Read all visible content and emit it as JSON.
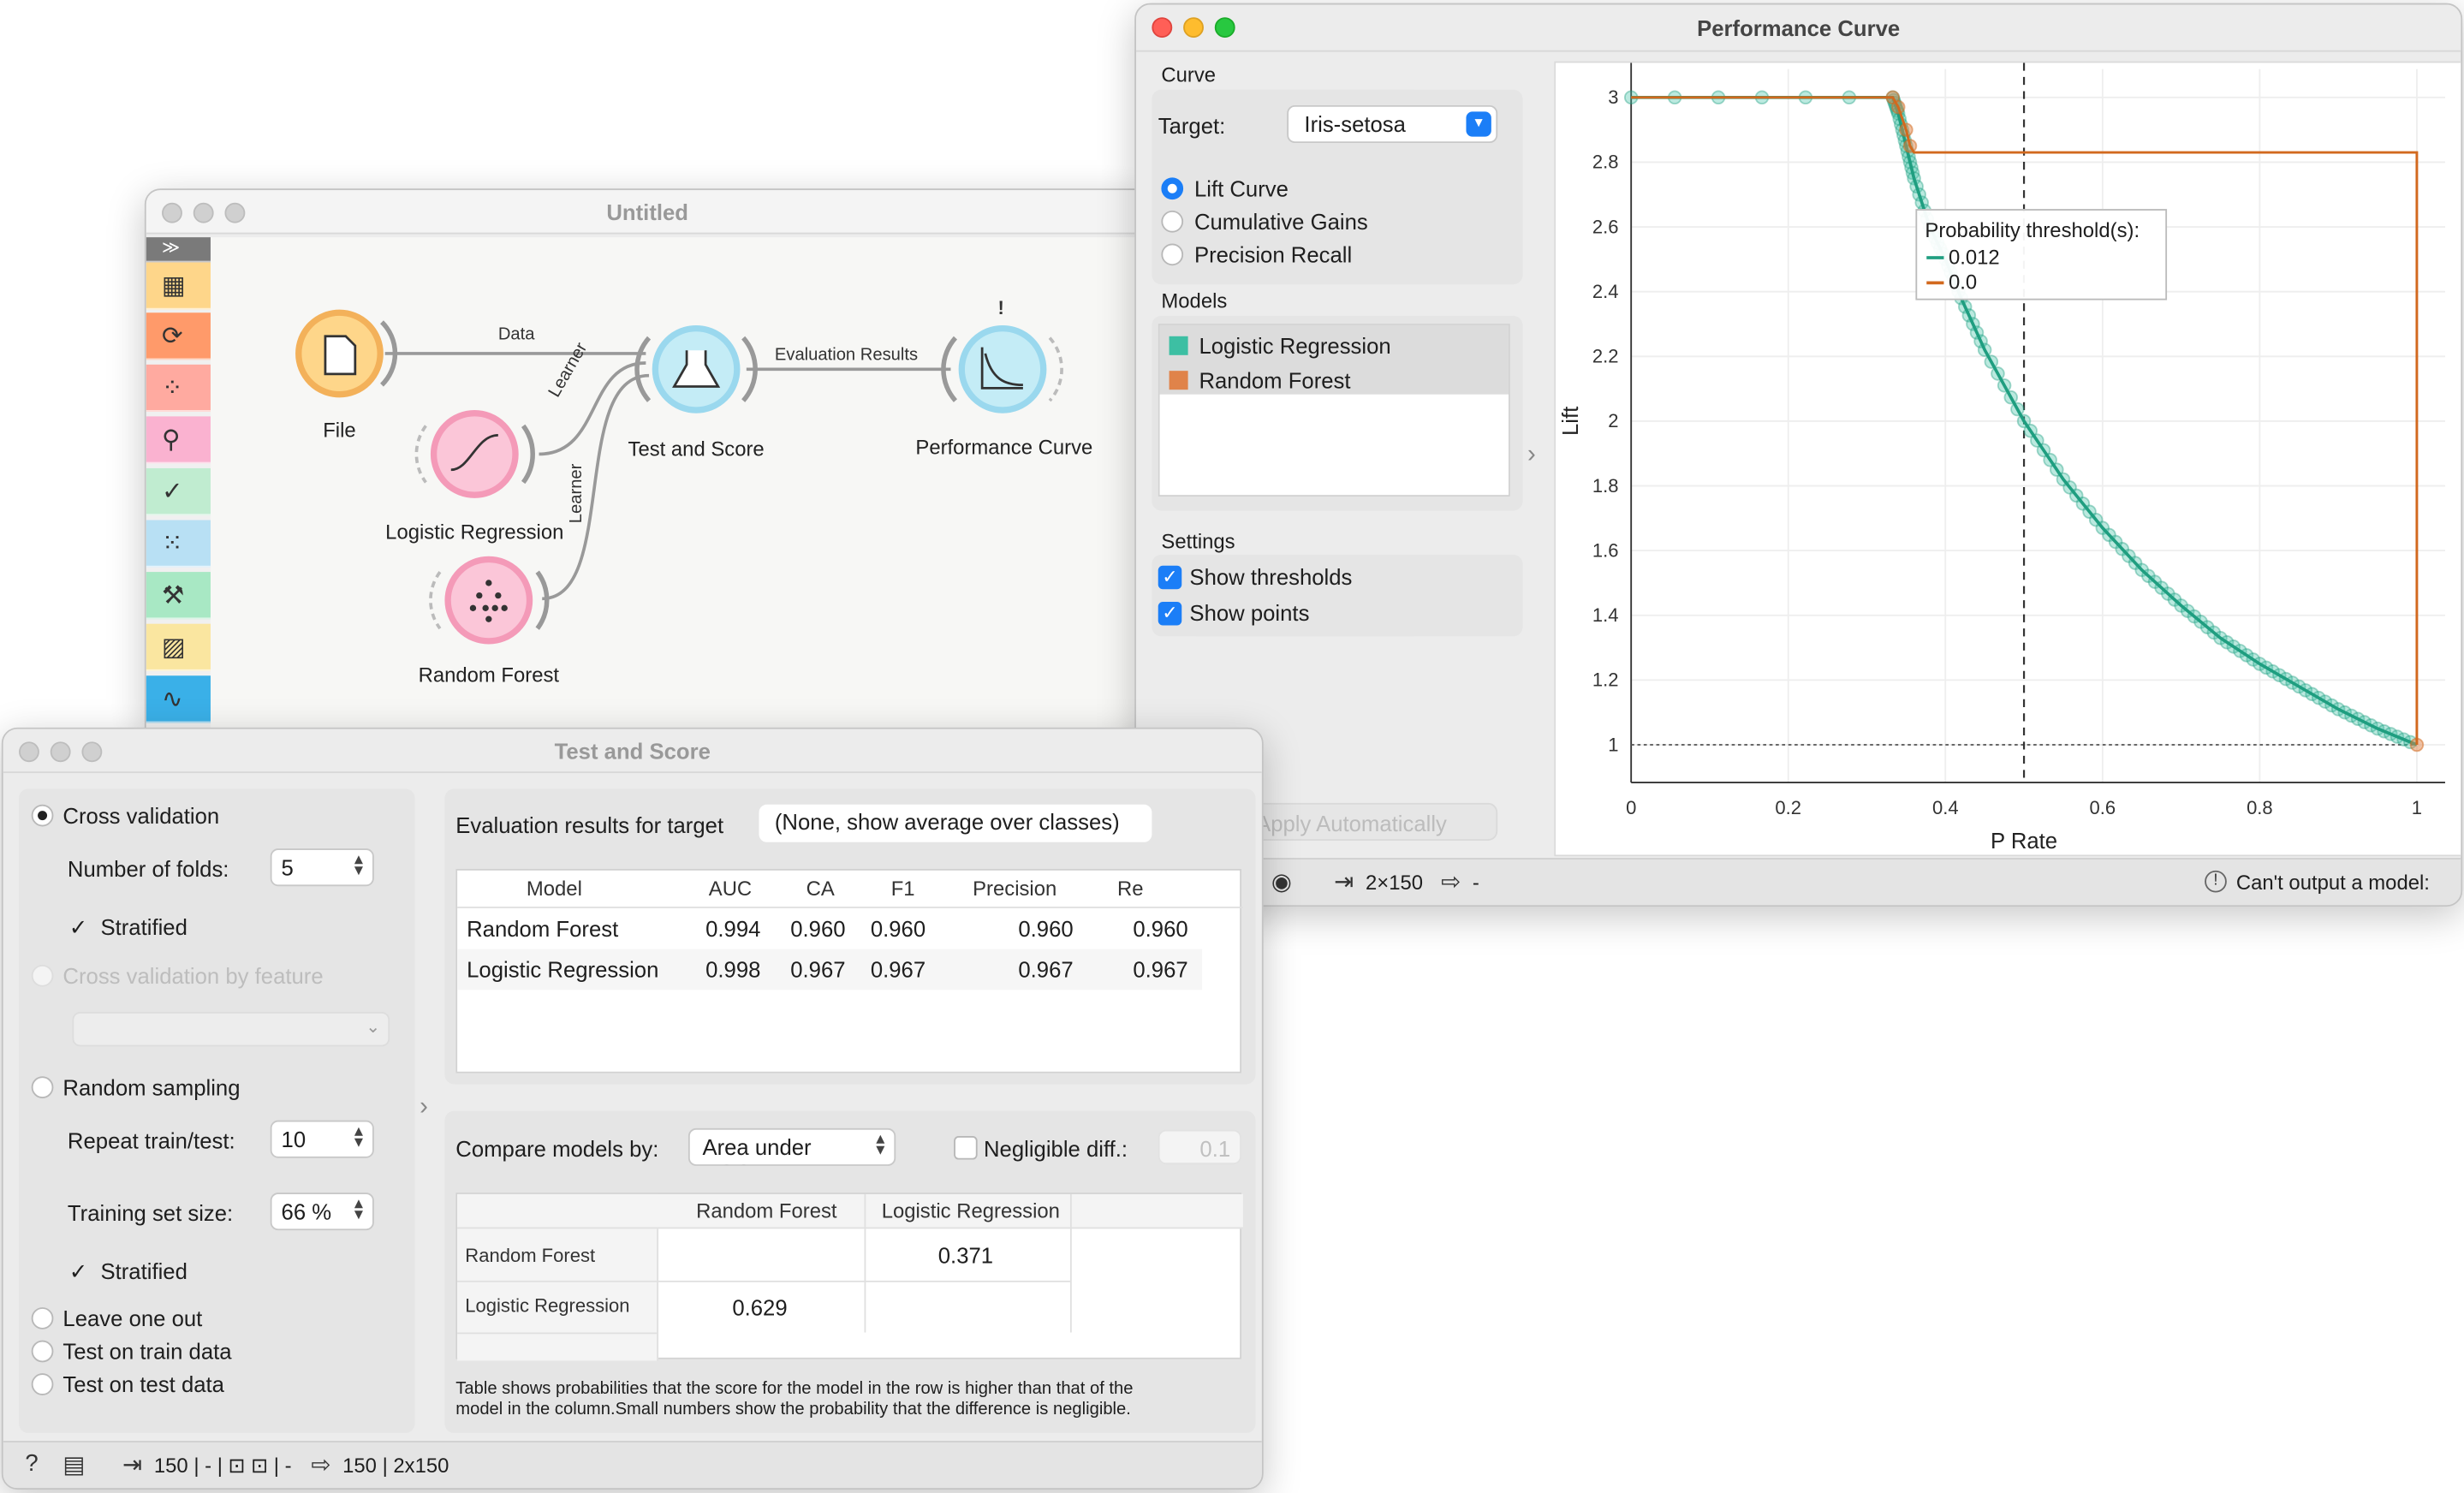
{
  "canvas_window": {
    "title": "Untitled",
    "nodes": {
      "file": "File",
      "logreg": "Logistic Regression",
      "testscore": "Test and Score",
      "perfcurve": "Performance Curve",
      "randforest": "Random Forest"
    },
    "links": {
      "data": "Data",
      "learner1": "Learner",
      "learner2": "Learner",
      "eval": "Evaluation Results"
    },
    "warning_badge": "!",
    "toolbox_icons": [
      "expand-icon",
      "data-table-icon",
      "transform-icon",
      "visualize-icon",
      "model-icon",
      "evaluate-icon",
      "unsupervised-icon",
      "spectroscopy-icon",
      "image-analytics-icon",
      "curve-icon"
    ]
  },
  "test_score_window": {
    "title": "Test and Score",
    "sampling": {
      "cross_validation": "Cross validation",
      "num_folds_label": "Number of folds:",
      "num_folds_value": "5",
      "stratified1": "Stratified",
      "cv_by_feature": "Cross validation by feature",
      "random_sampling": "Random sampling",
      "repeat_label": "Repeat train/test:",
      "repeat_value": "10",
      "train_size_label": "Training set size:",
      "train_size_value": "66 %",
      "stratified2": "Stratified",
      "leave_one_out": "Leave one out",
      "test_on_train": "Test on train data",
      "test_on_test": "Test on test data"
    },
    "eval_target_label": "Evaluation results for target",
    "eval_target_value": "(None, show average over classes)",
    "results_table": {
      "headers": [
        "Model",
        "AUC",
        "CA",
        "F1",
        "Precision",
        "Re"
      ],
      "rows": [
        [
          "Random Forest",
          "0.994",
          "0.960",
          "0.960",
          "0.960",
          "0.960"
        ],
        [
          "Logistic Regression",
          "0.998",
          "0.967",
          "0.967",
          "0.967",
          "0.967"
        ]
      ]
    },
    "compare_label": "Compare models by:",
    "compare_value": "Area under ROC",
    "negligible_label": "Negligible diff.:",
    "negligible_value": "0.1",
    "compare_table": {
      "headers": [
        "Random Forest",
        "Logistic Regression"
      ],
      "row_labels": [
        "Random Forest",
        "Logistic Regression"
      ],
      "values": [
        [
          "",
          "0.371"
        ],
        [
          "0.629",
          ""
        ]
      ]
    },
    "note_line1": "Table shows probabilities that the score for the model in the row is higher than that of the",
    "note_line2": "model in the column.Small numbers show the probability that the difference is negligible.",
    "status": {
      "input": "150 | - | ⊡ ⊡ | -",
      "output": "150 | 2x150"
    }
  },
  "perf_window": {
    "title": "Performance Curve",
    "curve_section": "Curve",
    "target_label": "Target:",
    "target_value": "Iris-setosa",
    "curve_options": [
      "Lift Curve",
      "Cumulative Gains",
      "Precision Recall"
    ],
    "selected_curve": "Lift Curve",
    "models_section": "Models",
    "models": [
      {
        "name": "Logistic Regression",
        "color": "#3dbfa3"
      },
      {
        "name": "Random Forest",
        "color": "#e0834a"
      }
    ],
    "settings_section": "Settings",
    "show_thresholds": "Show thresholds",
    "show_points": "Show points",
    "apply_auto": "Apply Automatically",
    "status": {
      "input": "2×150",
      "output": "-",
      "warning": "Can't output a model:"
    },
    "tooltip": {
      "title": "Probability threshold(s):",
      "lines": [
        {
          "text": "0.012",
          "color": "#1f9e80"
        },
        {
          "text": "0.0",
          "color": "#d2691e"
        }
      ]
    }
  },
  "chart_data": {
    "type": "line",
    "xlabel": "P Rate",
    "ylabel": "Lift",
    "xlim": [
      0,
      1
    ],
    "ylim": [
      1,
      3
    ],
    "x_ticks": [
      "0",
      "0.2",
      "0.4",
      "0.6",
      "0.8",
      "1"
    ],
    "y_ticks": [
      "1",
      "1.2",
      "1.4",
      "1.6",
      "1.8",
      "2",
      "2.2",
      "2.4",
      "2.6",
      "2.8",
      "3"
    ],
    "threshold_x": 0.5,
    "baseline_y": 1,
    "series": [
      {
        "name": "Logistic Regression",
        "color": "#1f9e80",
        "x": [
          0,
          0.333,
          0.34,
          0.35,
          0.36,
          0.38,
          0.4,
          0.42,
          0.45,
          0.5,
          0.55,
          0.6,
          0.65,
          0.7,
          0.75,
          0.8,
          0.85,
          0.9,
          0.95,
          1.0
        ],
        "y": [
          3,
          3,
          2.95,
          2.85,
          2.75,
          2.6,
          2.5,
          2.38,
          2.22,
          2.0,
          1.82,
          1.67,
          1.54,
          1.43,
          1.33,
          1.25,
          1.18,
          1.11,
          1.05,
          1.0
        ]
      },
      {
        "name": "Random Forest",
        "color": "#d2691e",
        "x": [
          0,
          0.333,
          0.34,
          0.35,
          0.355,
          0.36,
          1.0,
          1.0
        ],
        "y": [
          3,
          3,
          2.97,
          2.9,
          2.85,
          2.83,
          2.83,
          1.0
        ]
      }
    ]
  }
}
